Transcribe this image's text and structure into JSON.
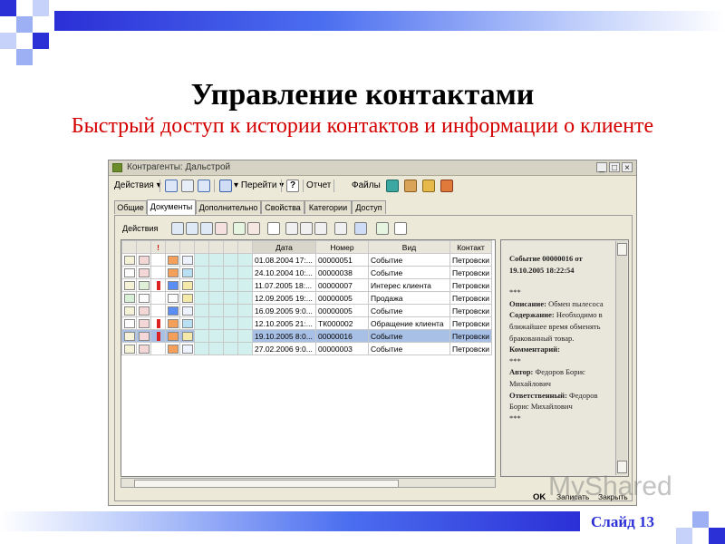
{
  "slide": {
    "title": "Управление контактами",
    "subtitle": "Быстрый доступ к истории контактов и информации о клиенте",
    "number": "Слайд 13",
    "watermark": "MyShared",
    "watermark_sub": "Закрыть"
  },
  "window": {
    "title": "Контрагенты: Дальстрой",
    "toolbar": {
      "actions": "Действия",
      "goto": "Перейти",
      "report": "Отчет",
      "files": "Файлы",
      "help": "?"
    },
    "tabs": [
      "Общие",
      "Документы",
      "Дополнительно",
      "Свойства",
      "Категории",
      "Доступ"
    ],
    "active_tab": "Документы",
    "pane_actions": "Действия",
    "table": {
      "columns": [
        "Дата",
        "Номер",
        "Вид",
        "Контакт"
      ],
      "rows": [
        {
          "date": "01.08.2004 17:...",
          "number": "00000051",
          "kind": "Событие",
          "contact": "Петровски"
        },
        {
          "date": "24.10.2004 10:...",
          "number": "00000038",
          "kind": "Событие",
          "contact": "Петровски"
        },
        {
          "date": "11.07.2005 18:...",
          "number": "00000007",
          "kind": "Интерес клиента",
          "contact": "Петровски"
        },
        {
          "date": "12.09.2005 19:...",
          "number": "00000005",
          "kind": "Продажа",
          "contact": "Петровски"
        },
        {
          "date": "16.09.2005 9:0...",
          "number": "00000005",
          "kind": "Событие",
          "contact": "Петровски"
        },
        {
          "date": "12.10.2005 21:...",
          "number": "ТК000002",
          "kind": "Обращение клиента",
          "contact": "Петровски"
        },
        {
          "date": "19.10.2005 8:0...",
          "number": "00000016",
          "kind": "Событие",
          "contact": "Петровски"
        },
        {
          "date": "27.02.2006 9:0...",
          "number": "00000003",
          "kind": "Событие",
          "contact": "Петровски"
        }
      ],
      "selected_row": 6
    },
    "detail": {
      "heading1": "Событие 00000016 от",
      "heading2": "19.10.2005 18:22:54",
      "stars1": "***",
      "desc_label": "Описание:",
      "desc_value": "Обмен пылесоса",
      "content_label": "Содержание:",
      "content_value": "Необходимо в ближайшее время обменять бракованный товар.",
      "comment_label": "Комментарий:",
      "stars2": "***",
      "author_label": "Автор:",
      "author_value": "Федоров Борис Михайлович",
      "resp_label": "Ответственный:",
      "resp_value": "Федоров Борис Михайлович",
      "stars3": "***"
    },
    "footer": {
      "ok": "OK",
      "write": "Записать",
      "close": "Закрыть"
    }
  },
  "colors": {
    "band": "#2b2fd6",
    "subtitle": "#d40000",
    "selected_row": "#a9c0e6"
  }
}
